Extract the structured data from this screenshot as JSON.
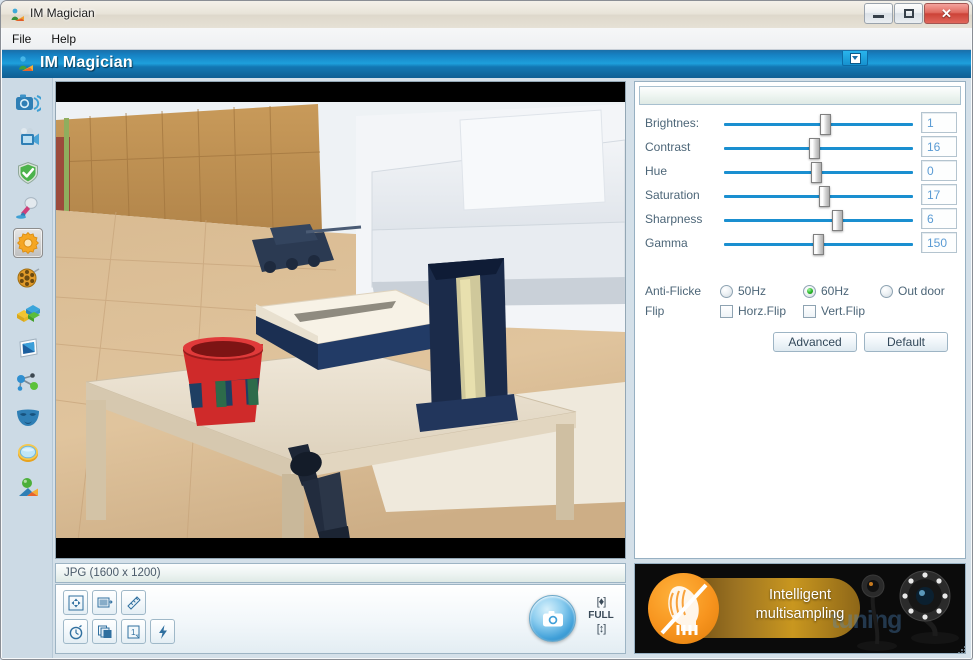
{
  "window": {
    "title": "IM Magician",
    "icon": "app-person-icon",
    "buttons": {
      "minimize": "–",
      "maximize": "□",
      "close": "✕"
    }
  },
  "menubar": {
    "items": [
      "File",
      "Help"
    ]
  },
  "header": {
    "title": "IM Magician",
    "collapse_icon": "chevron-down-boxed-icon"
  },
  "sidebar": {
    "items": [
      {
        "name": "camera-capture",
        "icon": "camera-icon",
        "selected": false
      },
      {
        "name": "video-record",
        "icon": "video-camera-icon",
        "selected": false
      },
      {
        "name": "security",
        "icon": "shield-check-icon",
        "selected": false
      },
      {
        "name": "audio-microphone",
        "icon": "microphone-icon",
        "selected": false
      },
      {
        "name": "settings",
        "icon": "gear-icon",
        "selected": true
      },
      {
        "name": "film-effects",
        "icon": "film-reel-icon",
        "selected": false
      },
      {
        "name": "color-blocks",
        "icon": "blocks-icon",
        "selected": false
      },
      {
        "name": "photo-frame",
        "icon": "photo-frame-icon",
        "selected": false
      },
      {
        "name": "network-share",
        "icon": "molecule-icon",
        "selected": false
      },
      {
        "name": "face-mask",
        "icon": "mask-icon",
        "selected": false
      },
      {
        "name": "lens-filter",
        "icon": "lens-oval-icon",
        "selected": false
      },
      {
        "name": "globe-world",
        "icon": "globe-bird-icon",
        "selected": false
      }
    ]
  },
  "preview": {
    "status_text": "JPG (1600 x 1200)",
    "alt": "webcam live preview of a living room with coffee table, red cup, tissue box and white sofa"
  },
  "toolbar": {
    "row1": [
      {
        "name": "resize-move-button",
        "icon": "move-arrows-icon"
      },
      {
        "name": "text-overlay-button",
        "icon": "text-box-icon"
      },
      {
        "name": "measure-button",
        "icon": "ruler-icon"
      }
    ],
    "row2": [
      {
        "name": "timer-button",
        "icon": "stopwatch-icon"
      },
      {
        "name": "burst-capture-button",
        "icon": "stacked-frames-icon"
      },
      {
        "name": "single-capture-button",
        "icon": "single-frame-icon"
      },
      {
        "name": "flash-button",
        "icon": "lightning-bolt-icon"
      }
    ],
    "capture": {
      "name": "capture-button",
      "icon": "camera-icon"
    },
    "size_top_icon": "expand-up-icon",
    "size_label": "FULL",
    "size_bottom_icon": "expand-sides-icon"
  },
  "settings": {
    "sliders": [
      {
        "label": "Brightnes:",
        "value": "1",
        "pos_pct": 51
      },
      {
        "label": "Contrast",
        "value": "16",
        "pos_pct": 45
      },
      {
        "label": "Hue",
        "value": "0",
        "pos_pct": 46
      },
      {
        "label": "Saturation",
        "value": "17",
        "pos_pct": 50
      },
      {
        "label": "Sharpness",
        "value": "6",
        "pos_pct": 57
      },
      {
        "label": "Gamma",
        "value": "150",
        "pos_pct": 47
      }
    ],
    "anti_flicker": {
      "label": "Anti-Flicke",
      "options": [
        {
          "label": "50Hz",
          "selected": false
        },
        {
          "label": "60Hz",
          "selected": true
        },
        {
          "label": "Out door",
          "selected": false
        }
      ]
    },
    "flip": {
      "label": "Flip",
      "options": [
        {
          "label": "Horz.Flip",
          "checked": false
        },
        {
          "label": "Vert.Flip",
          "checked": false
        }
      ]
    },
    "buttons": {
      "advanced": "Advanced",
      "default": "Default"
    }
  },
  "ad": {
    "line1": "Intelligent",
    "line2": "multisampling",
    "watermark": "tuning",
    "badge_icon": "no-noise-face-icon"
  },
  "colors": {
    "header_blue": "#1ea0dc",
    "slider_track": "#1a8fd0",
    "value_text": "#5a9bd4",
    "label_text": "#4d6678",
    "ad_orange": "#f7941e",
    "radio_green": "#27b527"
  }
}
